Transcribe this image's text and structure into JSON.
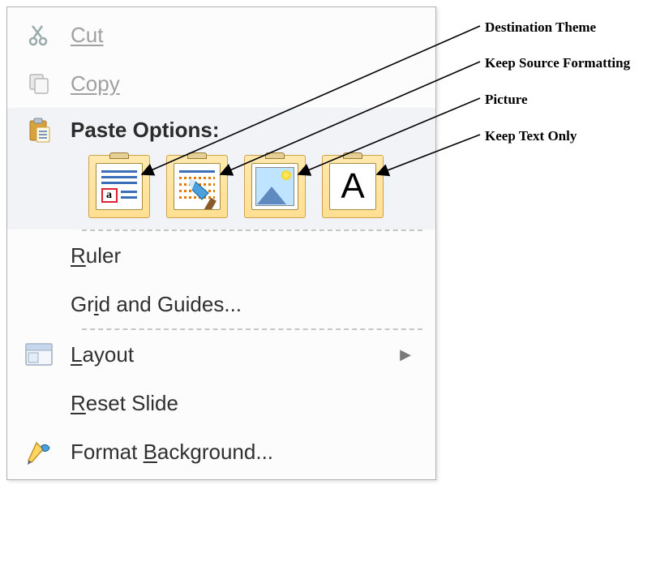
{
  "menu": {
    "cut": "Cut",
    "copy": "Copy",
    "paste_title": "Paste Options:",
    "paste_options": {
      "dest_theme": "Destination Theme",
      "source_fmt": "Keep Source Formatting",
      "picture": "Picture",
      "text_only": "Keep Text Only"
    },
    "ruler": "Ruler",
    "grid_guides": "Grid and Guides...",
    "layout": "Layout",
    "reset_slide": "Reset Slide",
    "format_bg": "Format Background..."
  },
  "annotations": {
    "dest_theme": "Destination Theme",
    "source_fmt": "Keep Source Formatting",
    "picture": "Picture",
    "text_only": "Keep Text Only"
  }
}
